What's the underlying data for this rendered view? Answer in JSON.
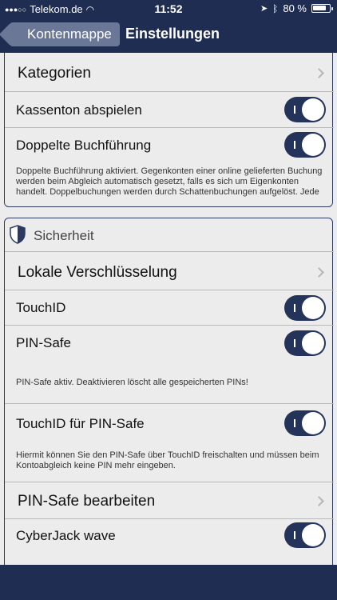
{
  "status": {
    "carrier": "Telekom.de",
    "time": "11:52",
    "battery": "80 %"
  },
  "nav": {
    "back_label": "Kontenmappe",
    "title": "Einstellungen"
  },
  "general": {
    "kategorien": "Kategorien",
    "kassenton": "Kassenton abspielen",
    "doppelte": "Doppelte Buchführung",
    "note": "Doppelte Buchführung aktiviert. Gegenkonten einer online gelieferten Buchung werden beim Abgleich automatisch gesetzt, falls es sich um Eigenkonten handelt. Doppelbuchungen werden durch Schattenbuchungen aufgelöst. Jede"
  },
  "security": {
    "title": "Sicherheit",
    "lokale": "Lokale Verschlüsselung",
    "touchid": "TouchID",
    "pinsafe": "PIN-Safe",
    "pinsafe_note": "PIN-Safe aktiv. Deaktivieren löscht alle gespeicherten PINs!",
    "touchid_pin": "TouchID für PIN-Safe",
    "touchid_pin_note": "Hiermit können Sie den PIN-Safe über TouchID freischalten und müssen beim Kontoabgleich keine PIN mehr eingeben.",
    "pin_edit": "PIN-Safe bearbeiten",
    "cyberjack": "CyberJack wave"
  },
  "toggles": {
    "kassenton": true,
    "doppelte": true,
    "touchid": true,
    "pinsafe": true,
    "touchid_pin": true,
    "cyberjack": true
  }
}
